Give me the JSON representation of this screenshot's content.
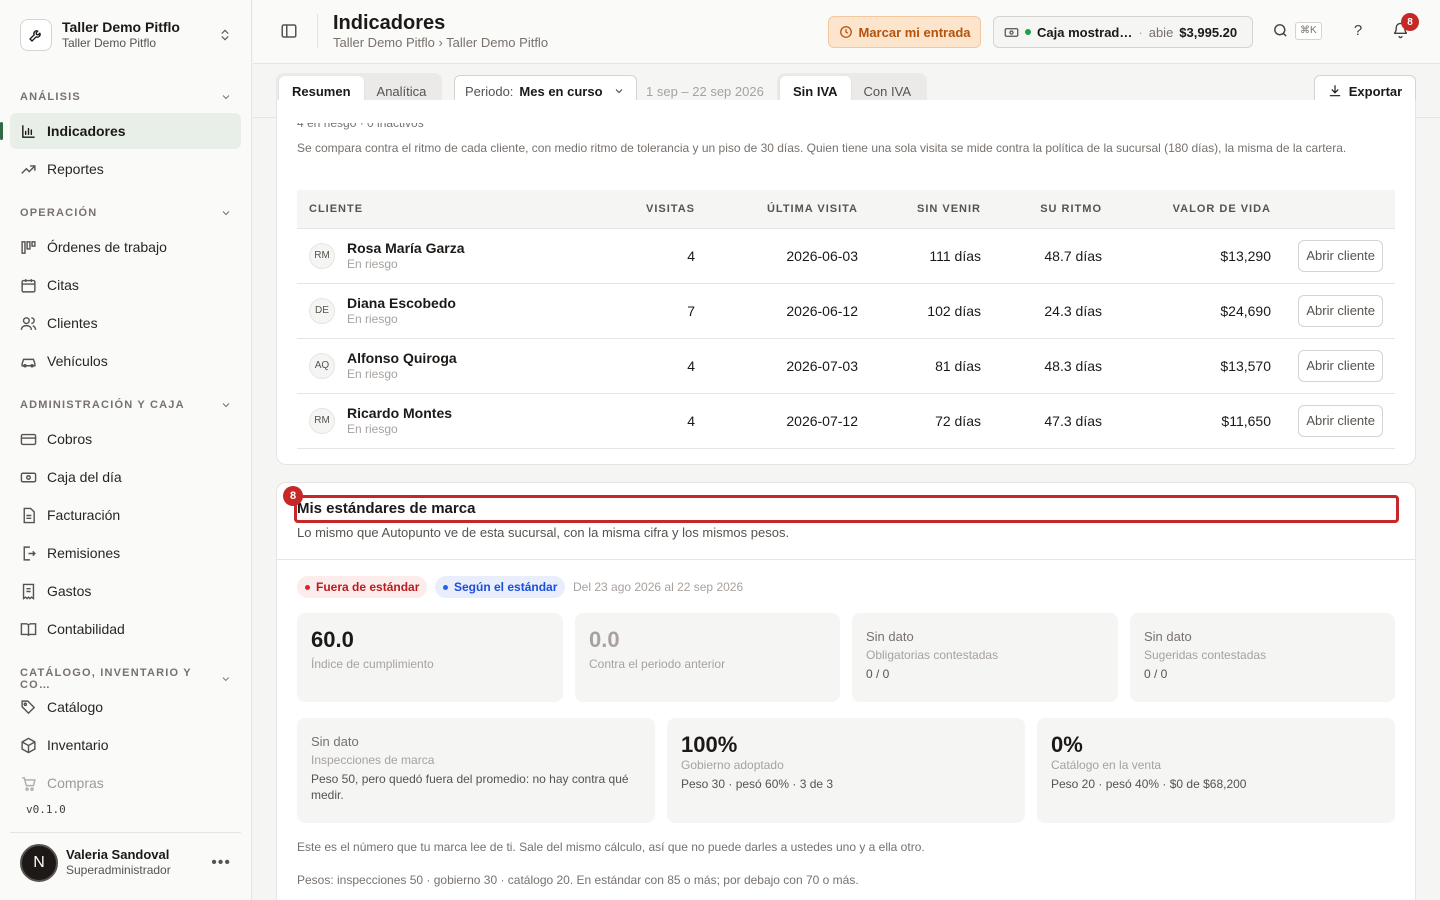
{
  "workspace": {
    "name": "Taller Demo Pitflo",
    "subtitle": "Taller Demo Pitflo"
  },
  "sidebar": {
    "sections": [
      {
        "label": "ANÁLISIS",
        "items": [
          {
            "label": "Indicadores",
            "icon": "bar-chart-icon",
            "active": true
          },
          {
            "label": "Reportes",
            "icon": "trend-up-icon"
          }
        ]
      },
      {
        "label": "OPERACIÓN",
        "items": [
          {
            "label": "Órdenes de trabajo",
            "icon": "kanban-icon"
          },
          {
            "label": "Citas",
            "icon": "calendar-icon"
          },
          {
            "label": "Clientes",
            "icon": "users-icon"
          },
          {
            "label": "Vehículos",
            "icon": "car-icon"
          }
        ]
      },
      {
        "label": "ADMINISTRACIÓN Y CAJA",
        "items": [
          {
            "label": "Cobros",
            "icon": "card-icon"
          },
          {
            "label": "Caja del día",
            "icon": "cash-icon"
          },
          {
            "label": "Facturación",
            "icon": "document-icon"
          },
          {
            "label": "Remisiones",
            "icon": "file-export-icon"
          },
          {
            "label": "Gastos",
            "icon": "receipt-icon"
          },
          {
            "label": "Contabilidad",
            "icon": "book-icon"
          }
        ]
      },
      {
        "label": "CATÁLOGO, INVENTARIO Y CO…",
        "items": [
          {
            "label": "Catálogo",
            "icon": "tag-icon"
          },
          {
            "label": "Inventario",
            "icon": "box-icon"
          },
          {
            "label": "Compras",
            "icon": "cart-icon"
          }
        ]
      }
    ],
    "version": "v0.1.0",
    "user": {
      "initial": "N",
      "name": "Valeria Sandoval",
      "role": "Superadministrador"
    }
  },
  "header": {
    "title": "Indicadores",
    "breadcrumb": "Taller Demo Pitflo › Taller Demo Pitflo",
    "clock_in_label": "Marcar mi entrada",
    "cash": {
      "name": "Caja mostrad…",
      "separator": "·",
      "status": "abie",
      "amount": "$3,995.20"
    },
    "search_shortcut": "⌘K",
    "help_label": "?",
    "notifications_count": "8"
  },
  "toolbar": {
    "view_tabs": [
      {
        "label": "Resumen",
        "selected": true
      },
      {
        "label": "Analítica",
        "selected": false
      }
    ],
    "period_label": "Periodo:",
    "period_value": "Mes en curso",
    "range_text": "1 sep – 22 sep 2026",
    "tax_tabs": [
      {
        "label": "Sin IVA",
        "selected": true
      },
      {
        "label": "Con IVA",
        "selected": false
      }
    ],
    "export_label": "Exportar"
  },
  "risk": {
    "summary": "4 en riesgo · 0 inactivos",
    "description": "Se compara contra el ritmo de cada cliente, con medio ritmo de tolerancia y un piso de 30 días. Quien tiene una sola visita se mide contra la política de la sucursal (180 días), la misma de la cartera.",
    "columns": [
      "CLIENTE",
      "VISITAS",
      "ÚLTIMA VISITA",
      "SIN VENIR",
      "SU RITMO",
      "VALOR DE VIDA"
    ],
    "rows": [
      {
        "initials": "RM",
        "name": "Rosa María Garza",
        "status": "En riesgo",
        "visits": "4",
        "last_visit": "2026-06-03",
        "absent": "111 días",
        "rhythm": "48.7 días",
        "lifetime": "$13,290",
        "action": "Abrir cliente"
      },
      {
        "initials": "DE",
        "name": "Diana Escobedo",
        "status": "En riesgo",
        "visits": "7",
        "last_visit": "2026-06-12",
        "absent": "102 días",
        "rhythm": "24.3 días",
        "lifetime": "$24,690",
        "action": "Abrir cliente"
      },
      {
        "initials": "AQ",
        "name": "Alfonso Quiroga",
        "status": "En riesgo",
        "visits": "4",
        "last_visit": "2026-07-03",
        "absent": "81 días",
        "rhythm": "48.3 días",
        "lifetime": "$13,570",
        "action": "Abrir cliente"
      },
      {
        "initials": "RM",
        "name": "Ricardo Montes",
        "status": "En riesgo",
        "visits": "4",
        "last_visit": "2026-07-12",
        "absent": "72 días",
        "rhythm": "47.3 días",
        "lifetime": "$11,650",
        "action": "Abrir cliente"
      }
    ]
  },
  "standards": {
    "badge": "8",
    "title": "Mis estándares de marca",
    "description": "Lo mismo que Autopunto ve de esta sucursal, con la misma cifra y los mismos pesos.",
    "pill_out": "Fuera de estándar",
    "pill_in": "Según el estándar",
    "range": "Del 23 ago 2026 al 22 sep 2026",
    "tiles_top": [
      {
        "value": "60.0",
        "label": "Índice de cumplimiento"
      },
      {
        "value": "0.0",
        "label": "Contra el periodo anterior"
      },
      {
        "value": "Sin dato",
        "label": "Obligatorias contestadas",
        "extra": "0 / 0"
      },
      {
        "value": "Sin dato",
        "label": "Sugeridas contestadas",
        "extra": "0 / 0"
      }
    ],
    "tiles_bottom": [
      {
        "value": "Sin dato",
        "label": "Inspecciones de marca",
        "extra": "Peso 50, pero quedó fuera del promedio: no hay contra qué medir."
      },
      {
        "value": "100%",
        "label": "Gobierno adoptado",
        "extra": "Peso 30 · pesó 60% · 3 de 3"
      },
      {
        "value": "0%",
        "label": "Catálogo en la venta",
        "extra": "Peso 20 · pesó 40% · $0 de $68,200"
      }
    ],
    "footnote_1": "Este es el número que tu marca lee de ti. Sale del mismo cálculo, así que no puede darles a ustedes uno y a ella otro.",
    "footnote_2": "Pesos: inspecciones 50 · gobierno 30 · catálogo 20. En estándar con 85 o más; por debajo con 70 o más."
  }
}
